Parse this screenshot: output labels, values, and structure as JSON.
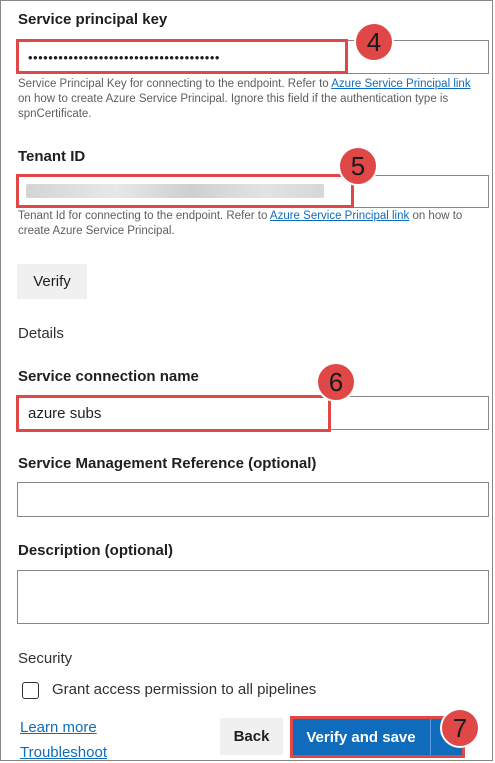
{
  "fields": {
    "spn_key": {
      "label": "Service principal key",
      "value": "••••••••••••••••••••••••••••••••••••••",
      "help_pre": "Service Principal Key for connecting to the endpoint. Refer to ",
      "help_link": "Azure Service Principal link",
      "help_post": " on how to create Azure Service Principal. Ignore this field if the authentication type is spnCertificate."
    },
    "tenant_id": {
      "label": "Tenant ID",
      "value": "",
      "help_pre": "Tenant Id for connecting to the endpoint. Refer to ",
      "help_link": "Azure Service Principal link",
      "help_post": " on how to create Azure Service Principal."
    },
    "connection_name": {
      "label": "Service connection name",
      "value": "azure subs"
    },
    "service_mgmt_ref": {
      "label": "Service Management Reference (optional)",
      "value": ""
    },
    "description": {
      "label": "Description (optional)",
      "value": ""
    }
  },
  "verify_label": "Verify",
  "details_heading": "Details",
  "security_heading": "Security",
  "grant_access_label": "Grant access permission to all pipelines",
  "links": {
    "learn_more": "Learn more",
    "troubleshoot": "Troubleshoot"
  },
  "buttons": {
    "back": "Back",
    "verify_save": "Verify and save"
  },
  "badges": {
    "b4": "4",
    "b5": "5",
    "b6": "6",
    "b7": "7"
  },
  "colors": {
    "accent": "#0f6cbd",
    "annotation": "#e04848"
  },
  "icons": {
    "dropdown": "chevron-down-icon"
  }
}
